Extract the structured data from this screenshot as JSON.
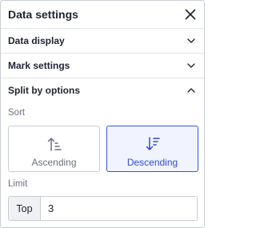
{
  "header": {
    "title": "Data settings",
    "close_icon": "close-icon"
  },
  "sections": [
    {
      "label": "Data display",
      "expanded": false,
      "icon": "chevron-down-icon"
    },
    {
      "label": "Mark settings",
      "expanded": false,
      "icon": "chevron-down-icon"
    },
    {
      "label": "Split by options",
      "expanded": true,
      "icon": "chevron-up-icon"
    }
  ],
  "split": {
    "sort_label": "Sort",
    "sort_options": [
      {
        "label": "Ascending",
        "selected": false,
        "icon": "sort-ascending-icon"
      },
      {
        "label": "Descending",
        "selected": true,
        "icon": "sort-descending-icon"
      }
    ],
    "limit_label": "Limit",
    "limit_prefix": "Top",
    "limit_value": "3"
  },
  "colors": {
    "accent": "#3a55d4",
    "border": "#c9ccd3",
    "muted_text": "#6b7080",
    "text": "#1f2430"
  }
}
